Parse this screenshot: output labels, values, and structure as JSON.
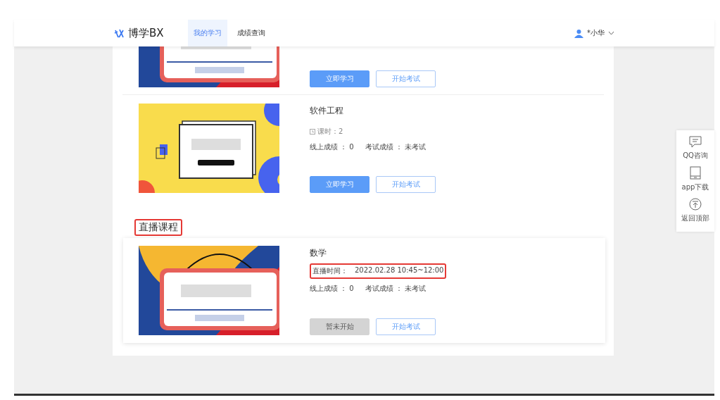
{
  "header": {
    "logo": "博学BX",
    "nav": [
      {
        "label": "我的学习",
        "selected": true
      },
      {
        "label": "成绩查询",
        "selected": false
      }
    ],
    "user": "*小华"
  },
  "courses": [
    {
      "kind": "partial",
      "buttons": [
        {
          "label": "立即学习",
          "disabled": false
        },
        {
          "label": "开始考试",
          "kind": "outline"
        }
      ]
    },
    {
      "kind": "recorded",
      "title": "软件工程",
      "hours": "课时：2",
      "online_score": "线上成绩 ： 0",
      "exam_score": "考试成绩 ： 未考试",
      "buttons": [
        {
          "label": "立即学习",
          "disabled": false
        },
        {
          "label": "开始考试",
          "kind": "outline"
        }
      ]
    }
  ],
  "live_section": {
    "title": "直播课程",
    "courses": [
      {
        "title": "数学",
        "live_time_label": "直播时间：",
        "live_time": "2022.02.28   10:45~12:00",
        "online_score": "线上成绩 ： 0",
        "exam_score": "考试成绩 ： 未考试",
        "buttons": [
          {
            "label": "暂未开始",
            "disabled": true
          },
          {
            "label": "开始考试",
            "kind": "outline"
          }
        ]
      }
    ]
  },
  "side_tools": [
    {
      "kind": "chat",
      "label": "QQ咨询"
    },
    {
      "kind": "tablet",
      "label": "app下载"
    },
    {
      "kind": "top",
      "label": "返回顶部"
    }
  ]
}
